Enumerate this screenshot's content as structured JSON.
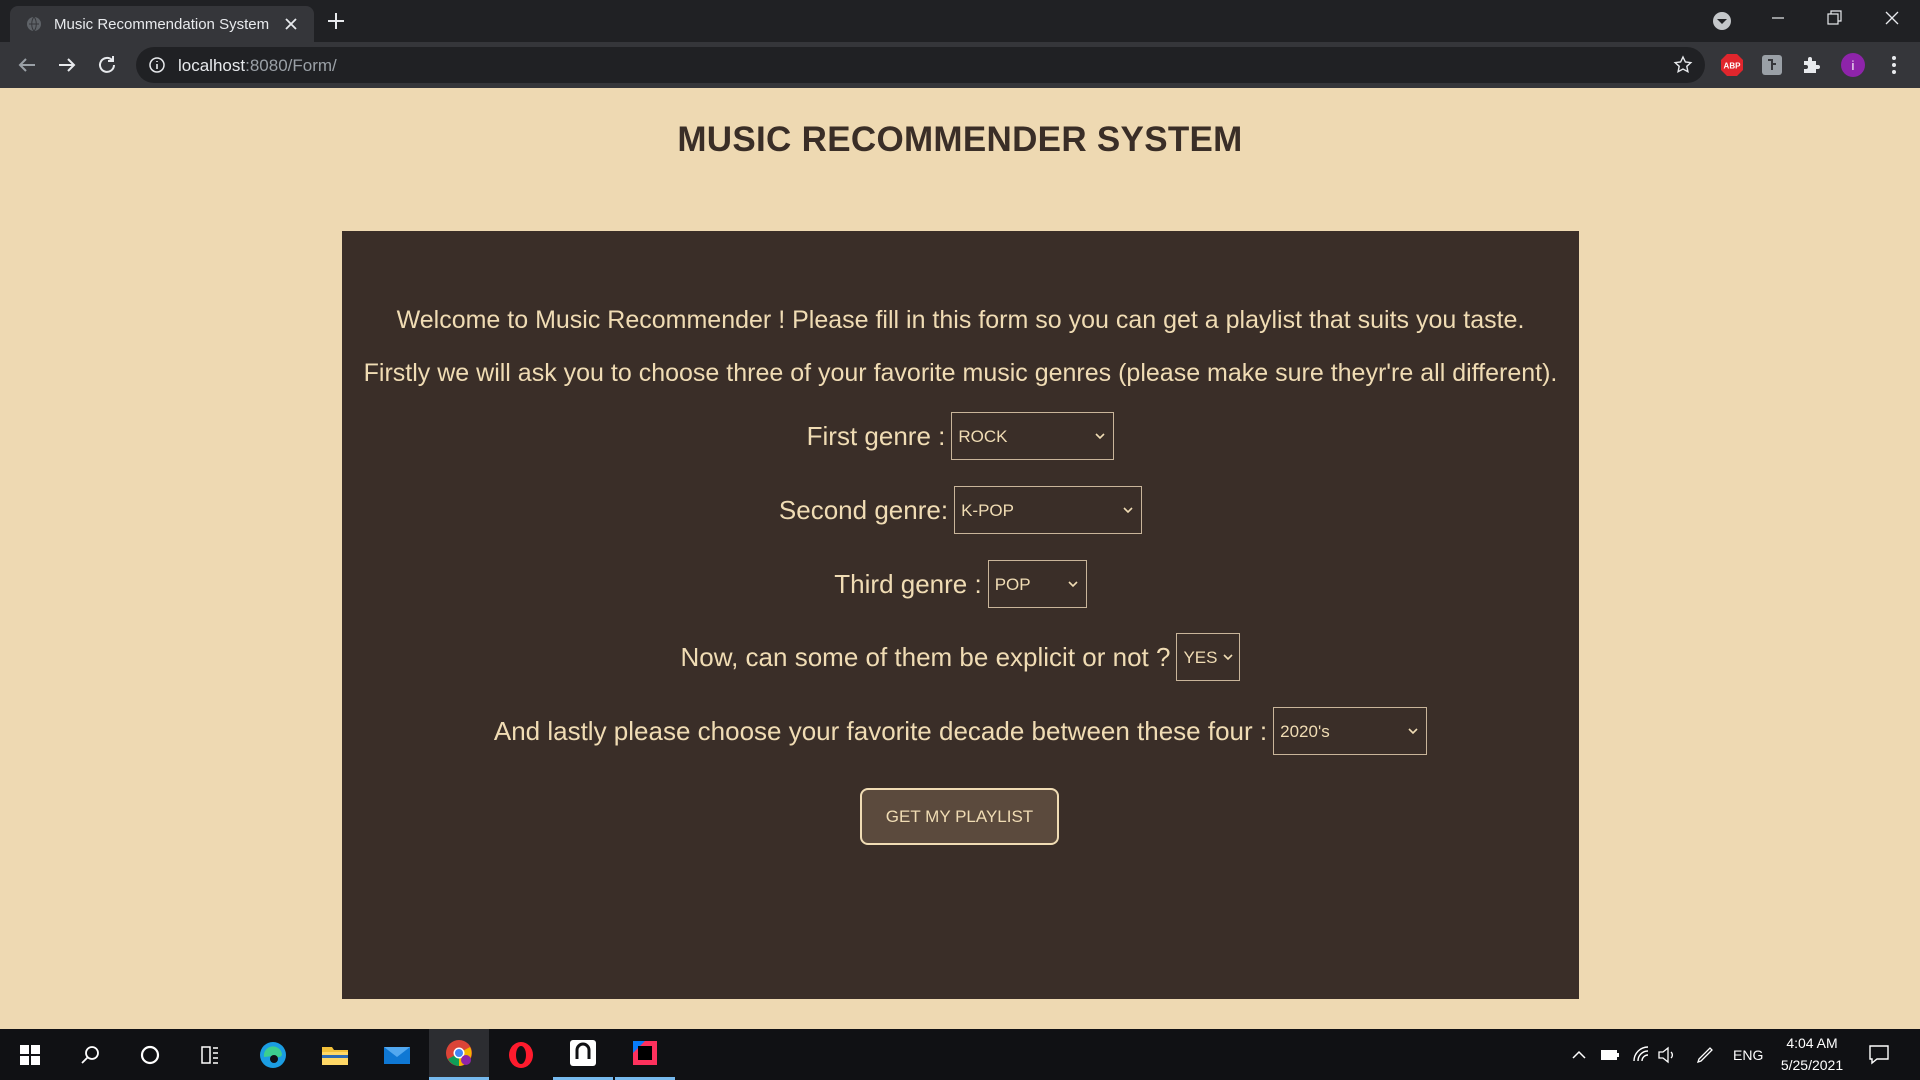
{
  "browser": {
    "tab_title": "Music Recommendation System",
    "url_host": "localhost",
    "url_rest": ":8080/Form/",
    "icons": [
      "close-icon",
      "plus-icon",
      "back-icon",
      "forward-icon",
      "reload-icon",
      "info-icon",
      "star-icon",
      "adblock-icon",
      "extension-icon",
      "puzzle-icon",
      "profile-icon",
      "menu-icon"
    ],
    "extension_abp": "ABP",
    "profile_initial": "i"
  },
  "page": {
    "title": "MUSIC RECOMMENDER SYSTEM",
    "intro_1": "Welcome to Music Recommender ! Please fill in this form so you can get a playlist that suits you taste.",
    "intro_2": "Firstly we will ask you to choose three of your favorite music genres (please make sure theyr're all different).",
    "first_genre_label": "First genre :",
    "first_genre_value": "ROCK",
    "second_genre_label": "Second genre:",
    "second_genre_value": "K-POP",
    "third_genre_label": "Third genre :",
    "third_genre_value": "POP",
    "explicit_label": "Now, can some of them be explicit or not ?",
    "explicit_value": "YES",
    "decade_label": "And lastly please choose your favorite decade between these four :",
    "decade_value": "2020's",
    "submit_label": "GET MY PLAYLIST"
  },
  "taskbar": {
    "language": "ENG",
    "time": "4:04 AM",
    "date": "5/25/2021"
  },
  "colors": {
    "page_bg": "#eed9b2",
    "panel_bg": "#3a2e28",
    "panel_text": "#f0dcb4",
    "title_text": "#3a2e27"
  }
}
